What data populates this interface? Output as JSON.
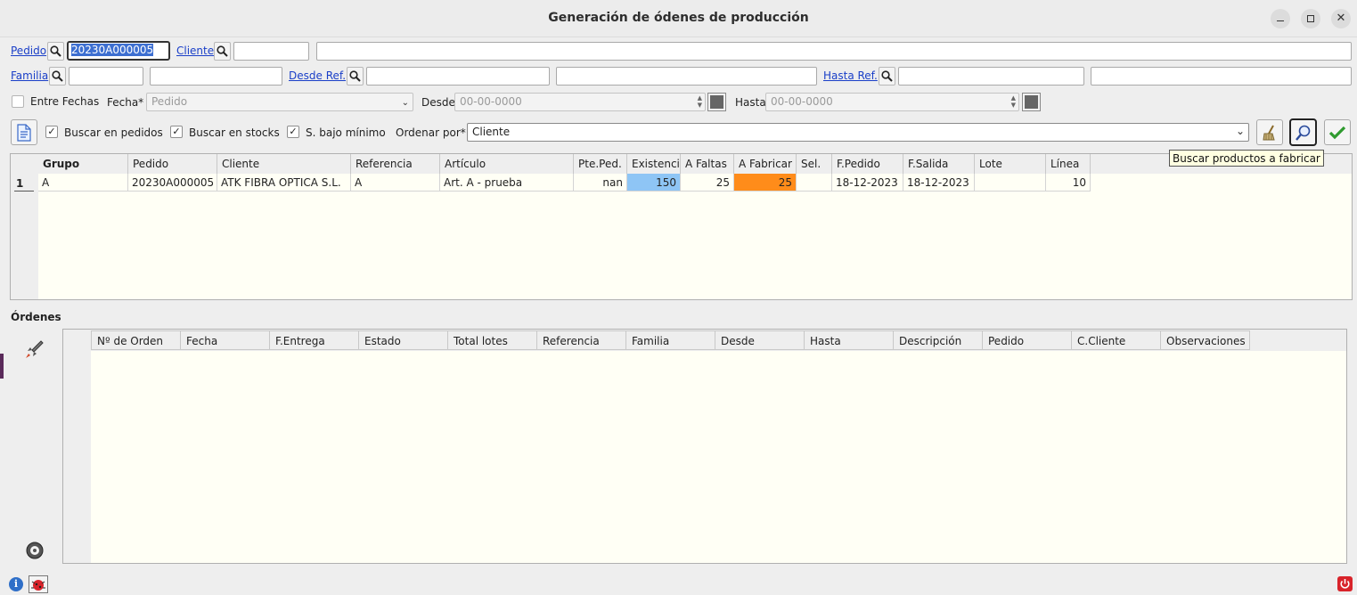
{
  "window": {
    "title": "Generación de ódenes de producción",
    "controls": [
      "minimize",
      "maximize",
      "close"
    ]
  },
  "filters": {
    "pedido_label": "Pedido",
    "pedido_value": "20230A000005",
    "cliente_label": "Cliente",
    "cliente_code": "",
    "cliente_name": "",
    "familia_label": "Familia",
    "familia_code": "",
    "familia_name": "",
    "desde_ref_label": "Desde Ref.",
    "desde_ref_code": "",
    "desde_ref_name": "",
    "hasta_ref_label": "Hasta Ref.",
    "hasta_ref_code": "",
    "hasta_ref_name": "",
    "entre_fechas_label": "Entre Fechas",
    "entre_fechas_checked": false,
    "fecha_label": "Fecha*",
    "fecha_value": "Pedido",
    "desde_label": "Desde",
    "desde_value": "00-00-0000",
    "hasta_label": "Hasta",
    "hasta_value": "00-00-0000"
  },
  "options": {
    "buscar_pedidos_label": "Buscar en pedidos",
    "buscar_pedidos_checked": true,
    "buscar_stocks_label": "Buscar en stocks",
    "buscar_stocks_checked": true,
    "bajo_minimo_label": "S. bajo mínimo",
    "bajo_minimo_checked": true,
    "ordenar_label": "Ordenar por*",
    "ordenar_value": "Cliente"
  },
  "tooltip": "Buscar productos a fabricar",
  "results_table": {
    "columns": [
      "Grupo",
      "Pedido",
      "Cliente",
      "Referencia",
      "Artículo",
      "Pte.Ped.",
      "Existencia",
      "A Faltas",
      "A Fabricar",
      "Sel.",
      "F.Pedido",
      "F.Salida",
      "Lote",
      "Línea"
    ],
    "rows": [
      {
        "num": "1",
        "grupo": "A",
        "pedido": "20230A000005",
        "cliente": "ATK FIBRA OPTICA S.L.",
        "referencia": "A",
        "articulo": "Art. A - prueba",
        "pte_ped": "nan",
        "existencia": "150",
        "a_faltas": "25",
        "a_fabricar": "25",
        "sel": "",
        "f_pedido": "18-12-2023",
        "f_salida": "18-12-2023",
        "lote": "",
        "linea": "10"
      }
    ],
    "highlight_colors": {
      "existencia": "#8ec5f5",
      "a_fabricar": "#ff8c1a"
    }
  },
  "orders": {
    "section_label": "Órdenes",
    "columns": [
      "Nº de Orden",
      "Fecha",
      "F.Entrega",
      "Estado",
      "Total lotes",
      "Referencia",
      "Familia",
      "Desde",
      "Hasta",
      "Descripción",
      "Pedido",
      "C.Cliente",
      "Observaciones"
    ],
    "rows": []
  }
}
